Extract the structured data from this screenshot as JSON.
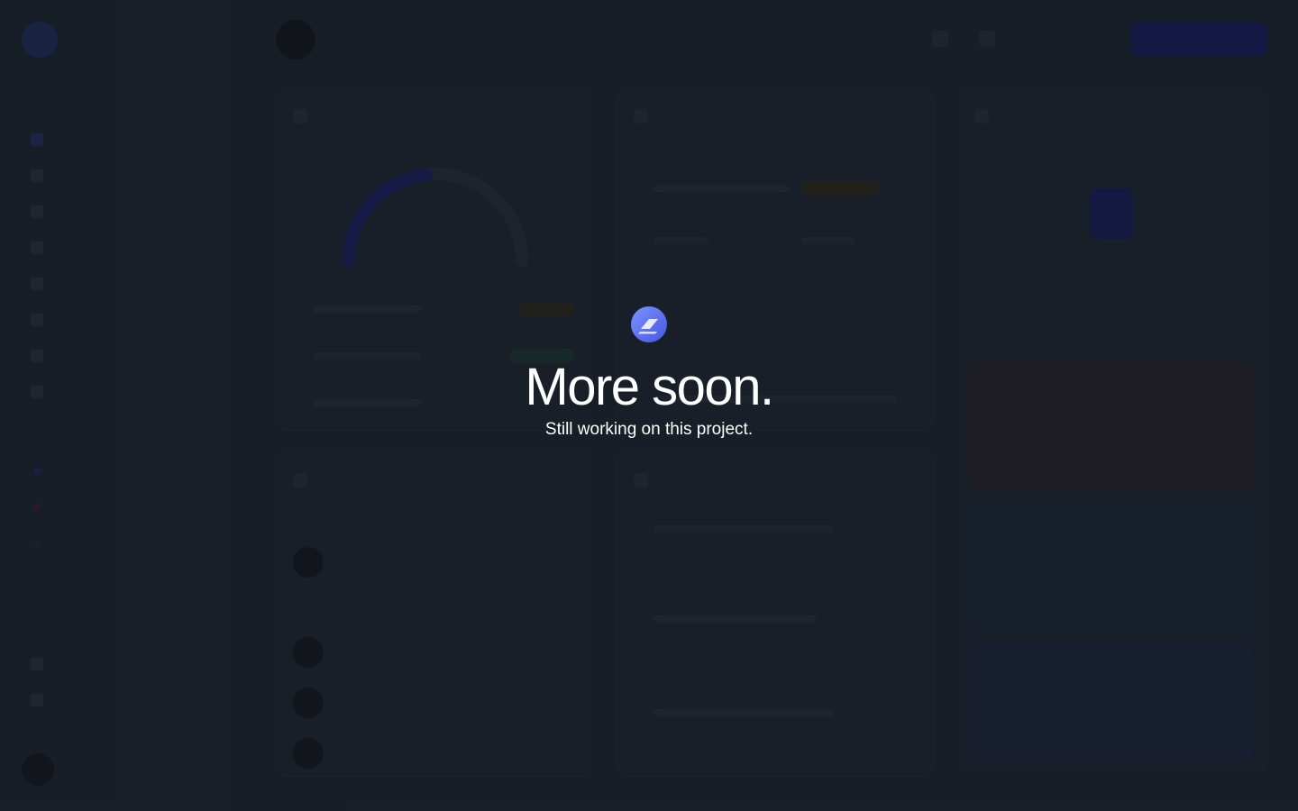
{
  "overlay": {
    "headline": "More soon.",
    "subline": "Still working on this project.",
    "logo_icon": "layers-logo-icon"
  },
  "colors": {
    "background": "#1b212a",
    "text": "#ffffff",
    "logo_gradient_start": "#6f86ff",
    "logo_gradient_end": "#4a5ee8"
  }
}
